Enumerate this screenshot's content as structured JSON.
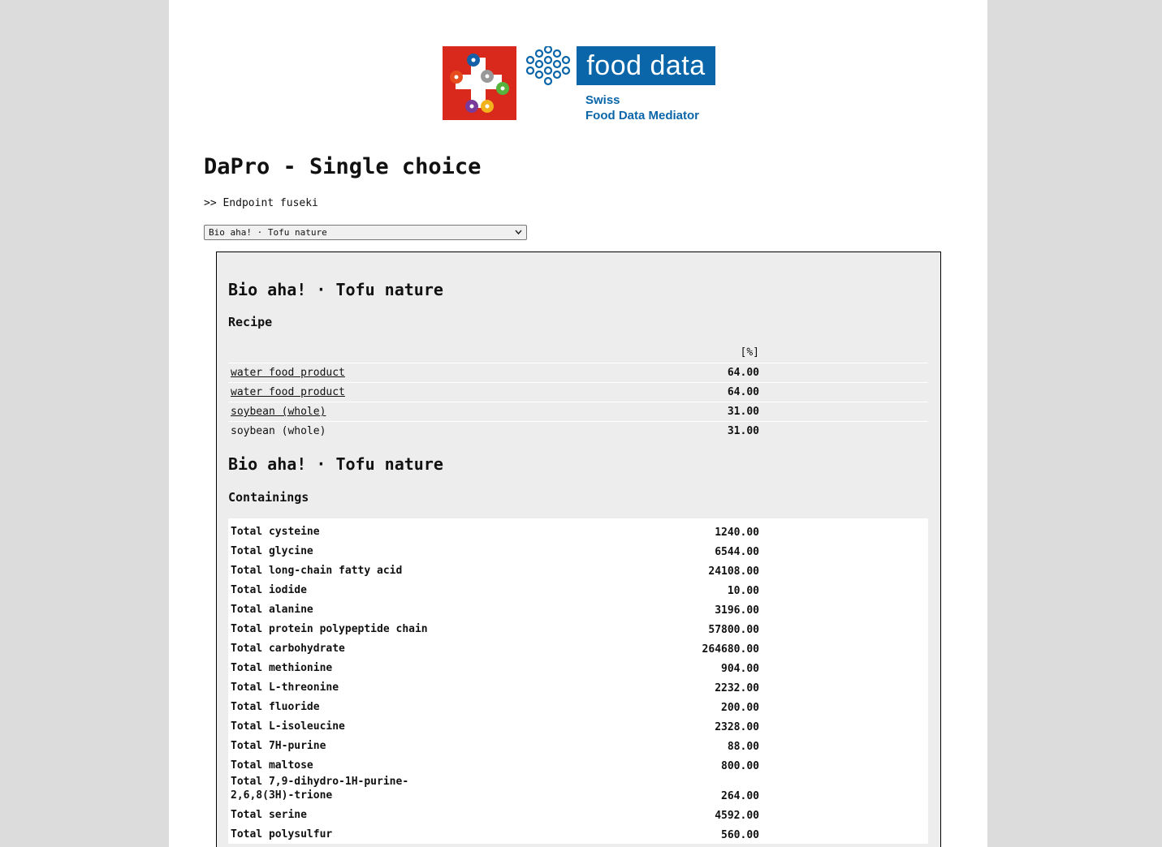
{
  "logo": {
    "banner_text": "food data",
    "subtitle_line1": "Swiss",
    "subtitle_line2": "Food Data Mediator",
    "brand_blue": "#0a66a8",
    "swiss_red": "#d9291c"
  },
  "page": {
    "title": "DaPro - Single choice",
    "endpoint": ">> Endpoint fuseki"
  },
  "select": {
    "selected": "Bio aha! · Tofu nature",
    "icon": "chevron-down-icon"
  },
  "recipe_section": {
    "product_title": "Bio aha! · Tofu nature",
    "heading": "Recipe",
    "unit_header": "[%]",
    "rows": [
      {
        "name": "water food product",
        "value": "64.00",
        "link": true
      },
      {
        "name": "water food product",
        "value": "64.00",
        "link": true
      },
      {
        "name": "soybean (whole)",
        "value": "31.00",
        "link": true
      },
      {
        "name": "soybean (whole)",
        "value": "31.00",
        "link": false
      }
    ]
  },
  "containings_section": {
    "product_title": "Bio aha! · Tofu nature",
    "heading": "Containings",
    "rows": [
      {
        "name": "Total cysteine",
        "value": "1240.00"
      },
      {
        "name": "Total glycine",
        "value": "6544.00"
      },
      {
        "name": "Total long-chain fatty acid",
        "value": "24108.00"
      },
      {
        "name": "Total iodide",
        "value": "10.00"
      },
      {
        "name": "Total alanine",
        "value": "3196.00"
      },
      {
        "name": "Total protein polypeptide chain",
        "value": "57800.00"
      },
      {
        "name": "Total carbohydrate",
        "value": "264680.00"
      },
      {
        "name": "Total methionine",
        "value": "904.00"
      },
      {
        "name": "Total L-threonine",
        "value": "2232.00"
      },
      {
        "name": "Total fluoride",
        "value": "200.00"
      },
      {
        "name": "Total L-isoleucine",
        "value": "2328.00"
      },
      {
        "name": "Total 7H-purine",
        "value": "88.00"
      },
      {
        "name": "Total maltose",
        "value": "800.00"
      },
      {
        "name": "Total 7,9-dihydro-1H-purine-2,6,8(3H)-trione",
        "value": "264.00"
      },
      {
        "name": "Total serine",
        "value": "4592.00"
      },
      {
        "name": "Total polysulfur",
        "value": "560.00"
      }
    ]
  }
}
